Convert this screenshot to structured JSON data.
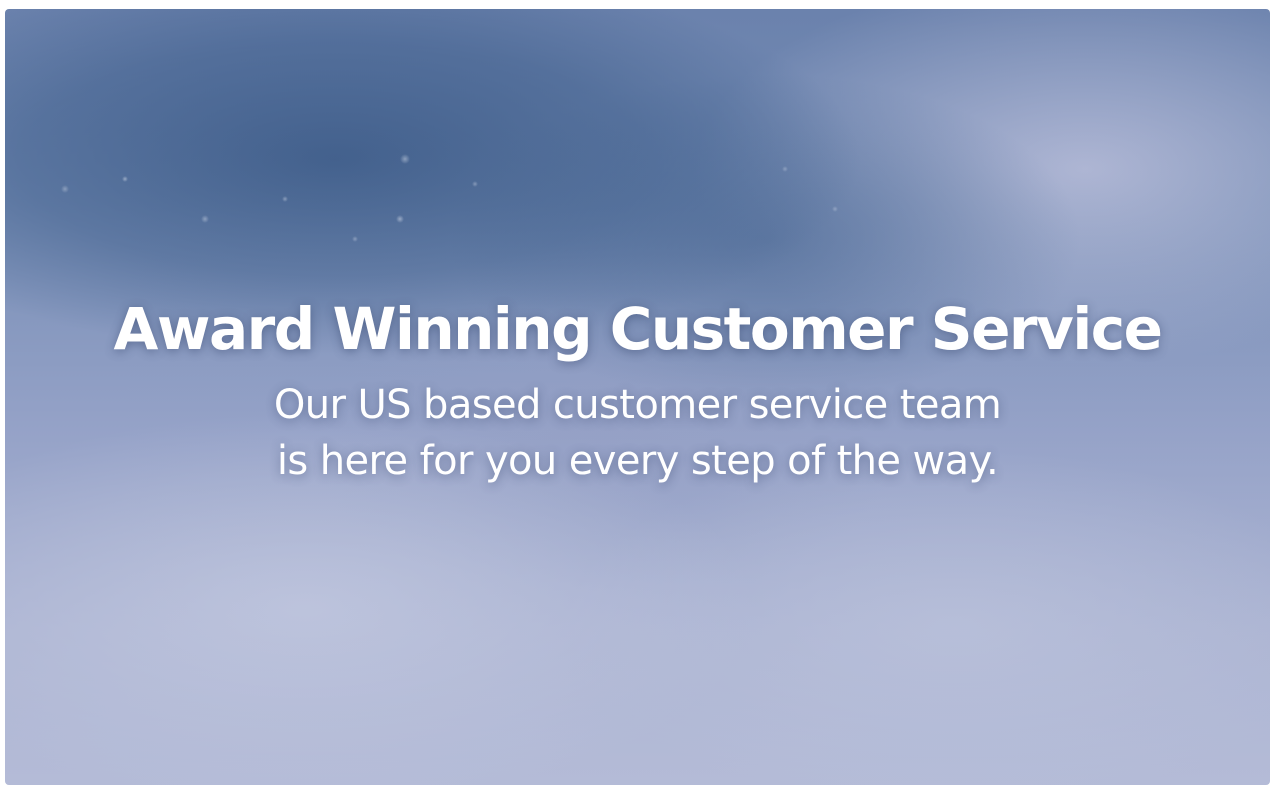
{
  "hero": {
    "title": "Award Winning Customer Service",
    "subtitle_line1": "Our US based customer service team",
    "subtitle_line2": "is here for you every step of the way.",
    "text_color": "#ffffff",
    "background_colors": [
      "#6b82ad",
      "#8d9bc3",
      "#aab2d1"
    ]
  }
}
